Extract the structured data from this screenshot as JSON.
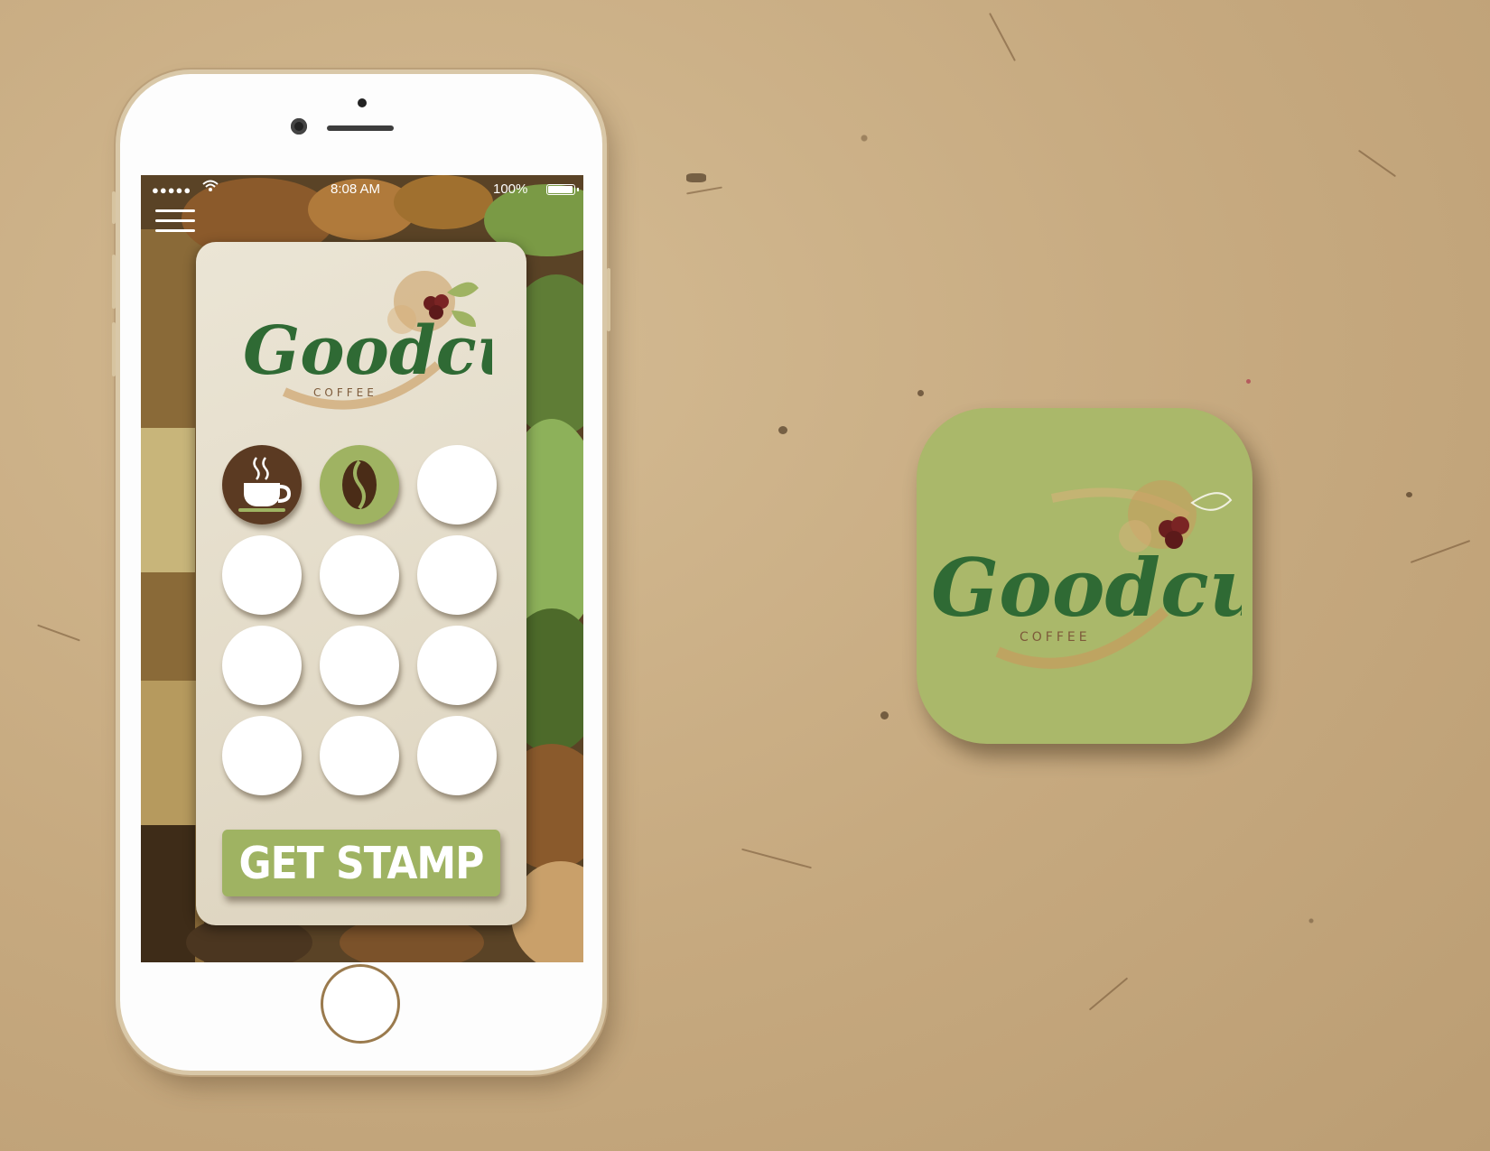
{
  "status_bar": {
    "signal": "●●●●●",
    "time": "8:08 AM",
    "battery_label": "100%",
    "battery_level": 1.0
  },
  "icons": {
    "menu": "hamburger-menu-icon",
    "wifi": "wifi-icon",
    "battery": "battery-icon",
    "stamp_cup": "coffee-cup-icon",
    "stamp_bean": "coffee-bean-icon"
  },
  "brand": {
    "name": "Goodcup",
    "tagline": "COFFEE",
    "colors": {
      "green_dark": "#2f6a34",
      "green_light": "#9fb362",
      "icon_bg": "#aab86a",
      "coffee_brown": "#5b3a22",
      "card": "#e6dfcd"
    }
  },
  "stamp_card": {
    "total_stamps": 12,
    "collected_stamps": 2,
    "stamps": [
      {
        "state": "collected",
        "icon": "coffee-cup-icon"
      },
      {
        "state": "collected",
        "icon": "coffee-bean-icon"
      },
      {
        "state": "empty"
      },
      {
        "state": "empty"
      },
      {
        "state": "empty"
      },
      {
        "state": "empty"
      },
      {
        "state": "empty"
      },
      {
        "state": "empty"
      },
      {
        "state": "empty"
      },
      {
        "state": "empty"
      },
      {
        "state": "empty"
      },
      {
        "state": "empty"
      }
    ],
    "button_label": "GET STAMP"
  },
  "app_icon": {
    "name": "Goodcup",
    "tagline": "COFFEE"
  }
}
